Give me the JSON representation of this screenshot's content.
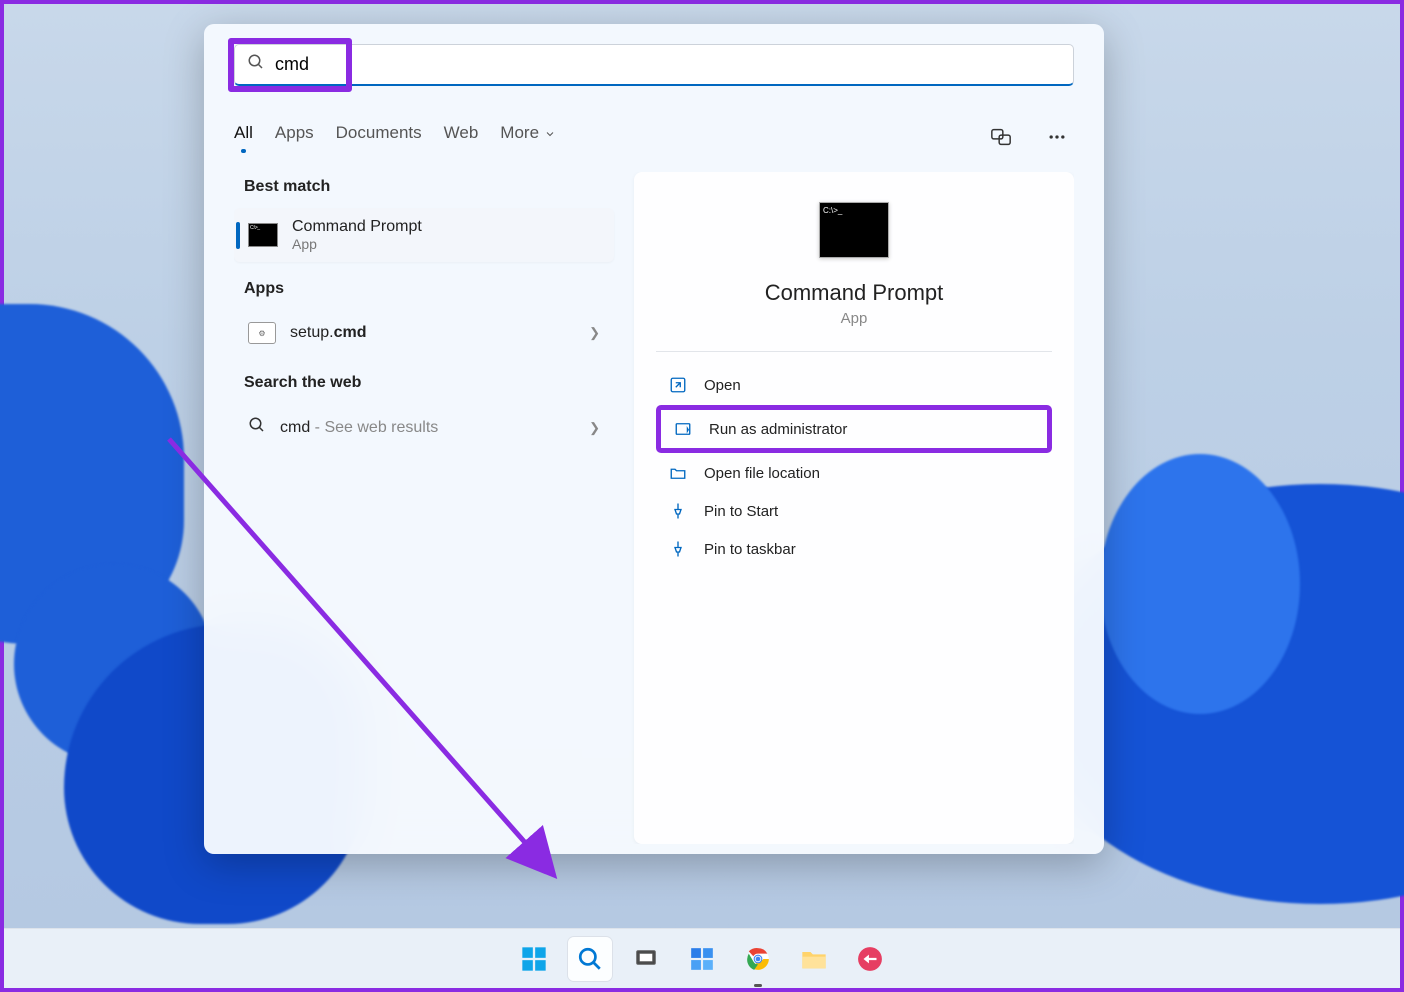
{
  "search": {
    "query": "cmd"
  },
  "tabs": {
    "all": "All",
    "apps": "Apps",
    "documents": "Documents",
    "web": "Web",
    "more": "More"
  },
  "sections": {
    "best_match": "Best match",
    "apps": "Apps",
    "search_web": "Search the web"
  },
  "results": {
    "best": {
      "title": "Command Prompt",
      "subtitle": "App"
    },
    "apps": [
      {
        "prefix": "setup.",
        "bold": "cmd"
      }
    ],
    "web": {
      "query": "cmd",
      "suffix": " - See web results"
    }
  },
  "detail": {
    "title": "Command Prompt",
    "subtitle": "App",
    "actions": {
      "open": "Open",
      "run_admin": "Run as administrator",
      "open_location": "Open file location",
      "pin_start": "Pin to Start",
      "pin_taskbar": "Pin to taskbar"
    }
  },
  "annotation_color": "#8a2be2"
}
